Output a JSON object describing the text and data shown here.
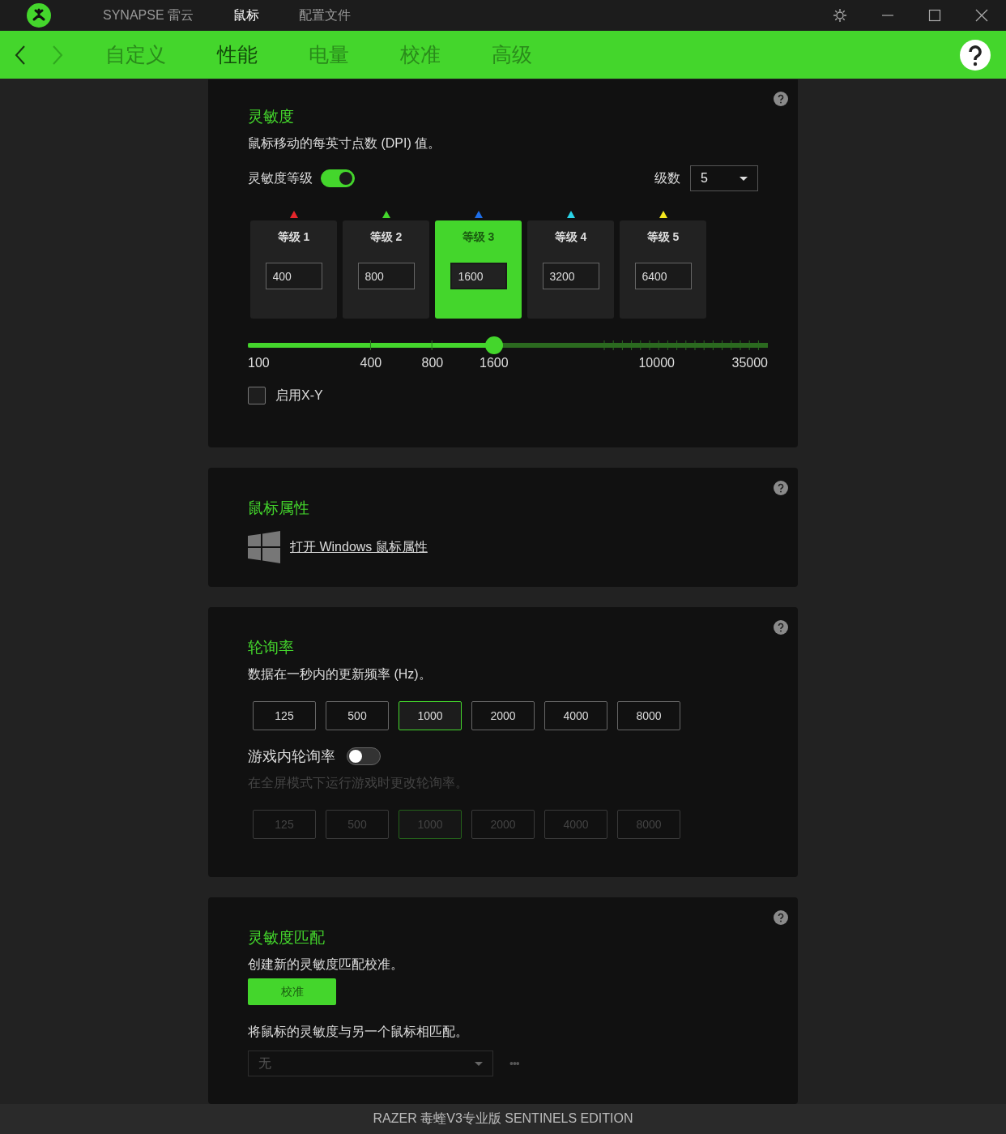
{
  "title_bar": {
    "tabs": [
      {
        "label": "SYNAPSE 雷云",
        "selected": false
      },
      {
        "label": "鼠标",
        "selected": true
      },
      {
        "label": "配置文件",
        "selected": false
      }
    ]
  },
  "nav": {
    "back": {
      "disabled": false
    },
    "forward": {
      "disabled": true
    },
    "tabs": [
      {
        "label": "自定义",
        "selected": false
      },
      {
        "label": "性能",
        "selected": true
      },
      {
        "label": "电量",
        "selected": false
      },
      {
        "label": "校准",
        "selected": false
      },
      {
        "label": "高级",
        "selected": false
      }
    ]
  },
  "sensitivity": {
    "title": "灵敏度",
    "description": "鼠标移动的每英寸点数 (DPI) 值。",
    "stages_toggle": {
      "label": "灵敏度等级",
      "on": true
    },
    "stage_count": {
      "label": "级数",
      "value": "5"
    },
    "stages": [
      {
        "label": "等级 1",
        "value": "400",
        "color": "#e8262b",
        "selected": false
      },
      {
        "label": "等级 2",
        "value": "800",
        "color": "#44d62c",
        "selected": false
      },
      {
        "label": "等级 3",
        "value": "1600",
        "color": "#1e6ee8",
        "selected": true
      },
      {
        "label": "等级 4",
        "value": "3200",
        "color": "#2ad4e8",
        "selected": false
      },
      {
        "label": "等级 5",
        "value": "6400",
        "color": "#f5e71e",
        "selected": false
      }
    ],
    "slider": {
      "level": 0.473,
      "labels": [
        "100",
        "400",
        "800",
        "1600",
        "10000",
        "35000"
      ]
    },
    "xy": {
      "label": "启用X-Y",
      "checked": false
    }
  },
  "mouse_properties": {
    "title": "鼠标属性",
    "link": "打开 Windows 鼠标属性"
  },
  "polling_rate": {
    "title": "轮询率",
    "description": "数据在一秒内的更新频率 (Hz)。",
    "rates": [
      {
        "label": "125",
        "selected": false
      },
      {
        "label": "500",
        "selected": false
      },
      {
        "label": "1000",
        "selected": true
      },
      {
        "label": "2000",
        "selected": false
      },
      {
        "label": "4000",
        "selected": false
      },
      {
        "label": "8000",
        "selected": false
      }
    ],
    "in_game": {
      "label": "游戏内轮询率",
      "on": false,
      "description": "在全屏模式下运行游戏时更改轮询率。",
      "disabled": true,
      "rates": [
        {
          "label": "125",
          "selected": false
        },
        {
          "label": "500",
          "selected": false
        },
        {
          "label": "1000",
          "selected": true
        },
        {
          "label": "2000",
          "selected": false
        },
        {
          "label": "4000",
          "selected": false
        },
        {
          "label": "8000",
          "selected": false
        }
      ]
    }
  },
  "sensitivity_matching": {
    "title": "灵敏度匹配",
    "description": "创建新的灵敏度匹配校准。",
    "button": "校准",
    "match_description": "将鼠标的灵敏度与另一个鼠标相匹配。",
    "dropdown": {
      "value": "无",
      "disabled": true
    },
    "more": "•••"
  },
  "footer": "RAZER 毒蝰V3专业版 SENTINELS EDITION"
}
